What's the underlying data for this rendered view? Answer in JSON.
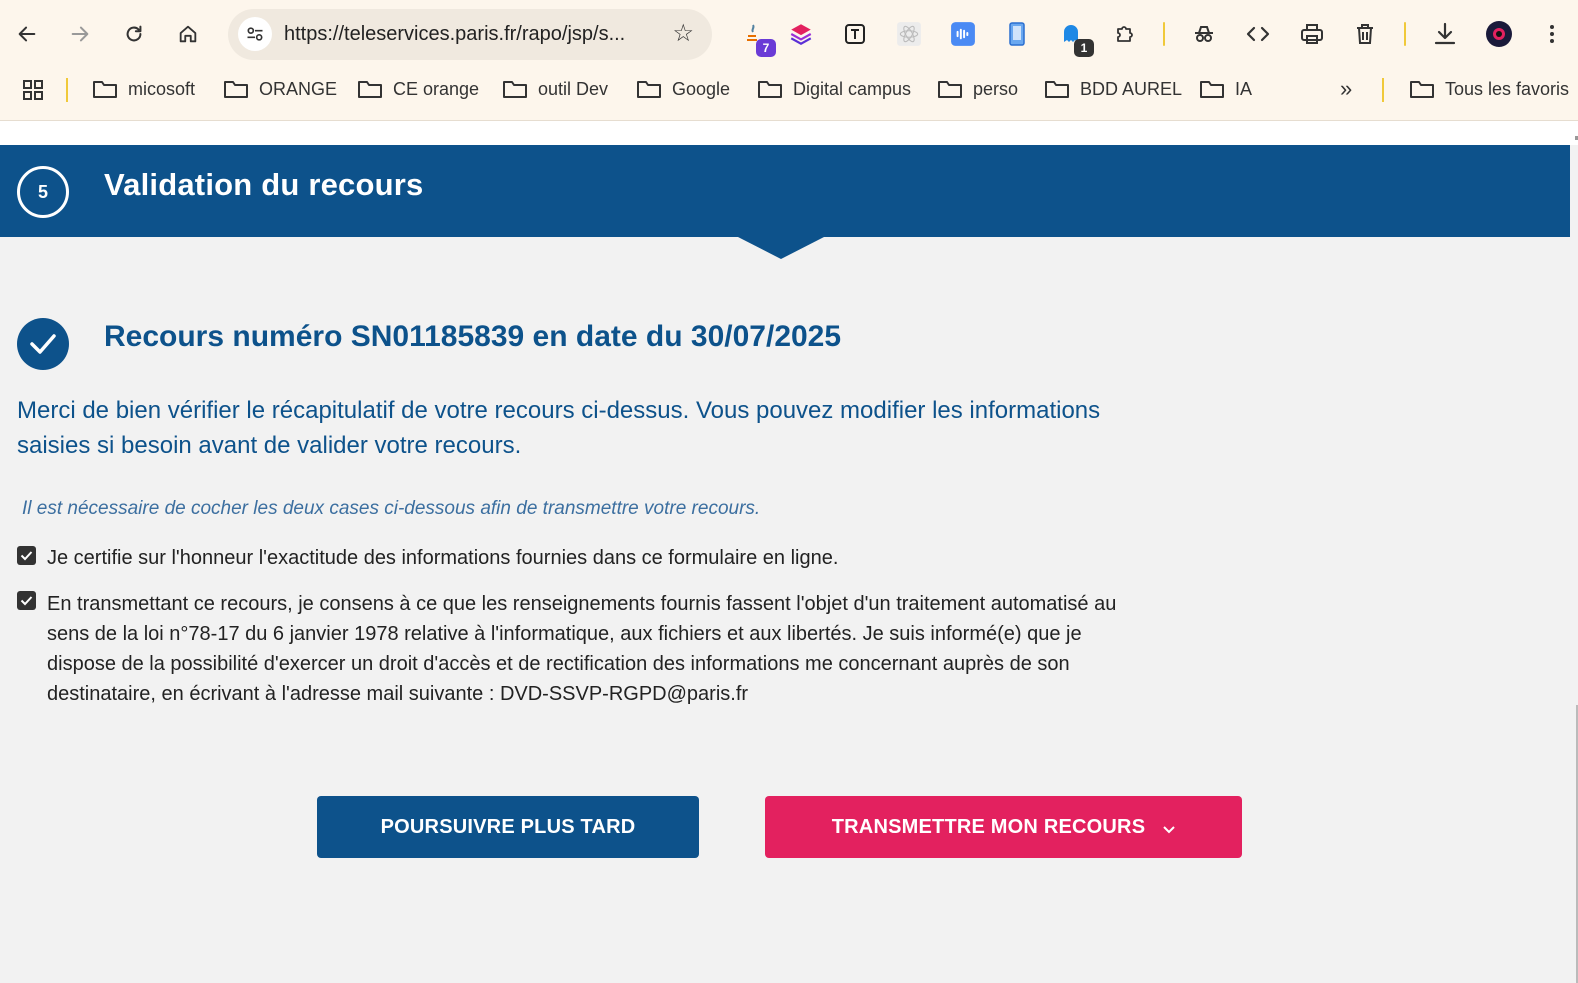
{
  "browser": {
    "url": "https://teleservices.paris.fr/rapo/jsp/s...",
    "extension_badges": [
      "7",
      "1"
    ],
    "bookmarks": [
      "micosoft",
      "ORANGE",
      "CE orange",
      "outil Dev",
      "Google",
      "Digital campus",
      "perso",
      "BDD AUREL",
      "IA"
    ],
    "more_label": "»",
    "all_bookmarks_label": "Tous les favoris"
  },
  "header": {
    "step_number": "5",
    "title": "Validation du recours"
  },
  "main": {
    "recours_title": "Recours numéro SN01185839 en date du 30/07/2025",
    "intro": "Merci de bien vérifier le récapitulatif de votre recours ci-dessus. Vous pouvez modifier les informations saisies si besoin avant de valider votre recours.",
    "note": "Il est nécessaire de cocher les deux cases ci-dessous afin de transmettre votre recours.",
    "checkboxes": [
      {
        "label": "Je certifie sur l'honneur l'exactitude des informations fournies dans ce formulaire en ligne.",
        "checked": true
      },
      {
        "label": "En transmettant ce recours, je consens à ce que les renseignements fournis fassent l'objet d'un traitement automatisé au sens de la loi n°78-17 du 6 janvier 1978 relative à l'informatique, aux fichiers et aux libertés. Je suis informé(e) que je dispose de la possibilité d'exercer un droit d'accès et de rectification des informations me concernant auprès de son destinataire, en écrivant à l'adresse mail suivante : DVD-SSVP-RGPD@paris.fr",
        "checked": true
      }
    ]
  },
  "actions": {
    "later_label": "POURSUIVRE PLUS TARD",
    "send_label": "TRANSMETTRE MON RECOURS"
  },
  "colors": {
    "primary": "#0d528b",
    "accent": "#e3215f",
    "background": "#f2f2f2"
  }
}
